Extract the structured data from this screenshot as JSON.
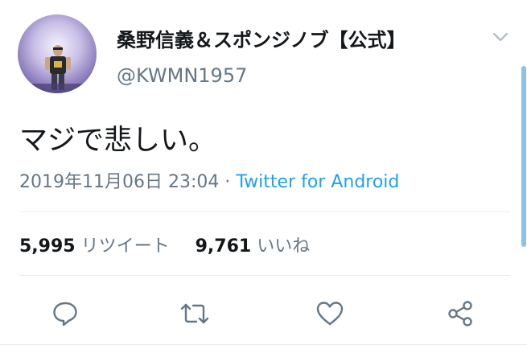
{
  "user": {
    "display_name": "桑野信義＆スポンジノブ【公式】",
    "handle": "@KWMN1957",
    "avatar_icon": "profile-photo"
  },
  "tweet": {
    "text": "マジで悲しい。",
    "timestamp": "2019年11月06日 23:04",
    "separator": " · ",
    "source": "Twitter for Android"
  },
  "stats": {
    "retweets_count": "5,995",
    "retweets_label": "リツイート",
    "likes_count": "9,761",
    "likes_label": "いいね"
  },
  "actions": {
    "reply_icon": "reply-icon",
    "retweet_icon": "retweet-icon",
    "like_icon": "heart-icon",
    "share_icon": "share-icon"
  },
  "colors": {
    "text": "#14171a",
    "muted": "#657786",
    "accent": "#1da1f2",
    "divider": "#e6ecf0",
    "scrollbar": "#8ec1ea"
  }
}
